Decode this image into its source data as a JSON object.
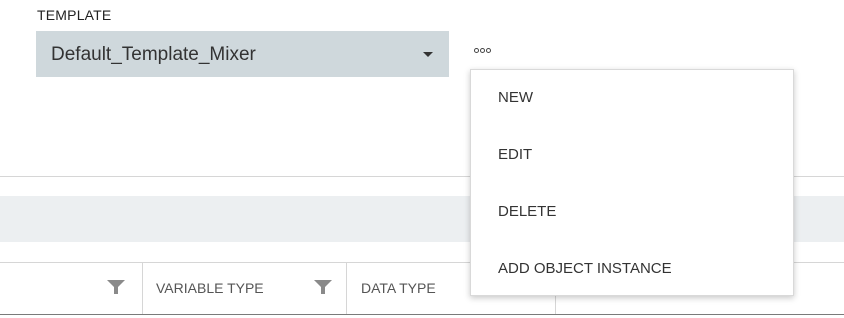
{
  "template": {
    "label": "TEMPLATE",
    "selected": "Default_Template_Mixer"
  },
  "more_menu": {
    "icon": "more-horizontal-icon",
    "items": [
      {
        "label": "NEW"
      },
      {
        "label": "EDIT"
      },
      {
        "label": "DELETE"
      },
      {
        "label": "ADD OBJECT INSTANCE"
      }
    ]
  },
  "table": {
    "columns": [
      {
        "label": "VARIABLE TYPE",
        "filter_icon": "filter-icon"
      },
      {
        "label": "DATA TYPE",
        "filter_icon": "filter-icon"
      }
    ]
  },
  "colors": {
    "select_background": "#cfd8dc",
    "band_background": "#eceff1",
    "filter_icon": "#8a8a8a"
  }
}
